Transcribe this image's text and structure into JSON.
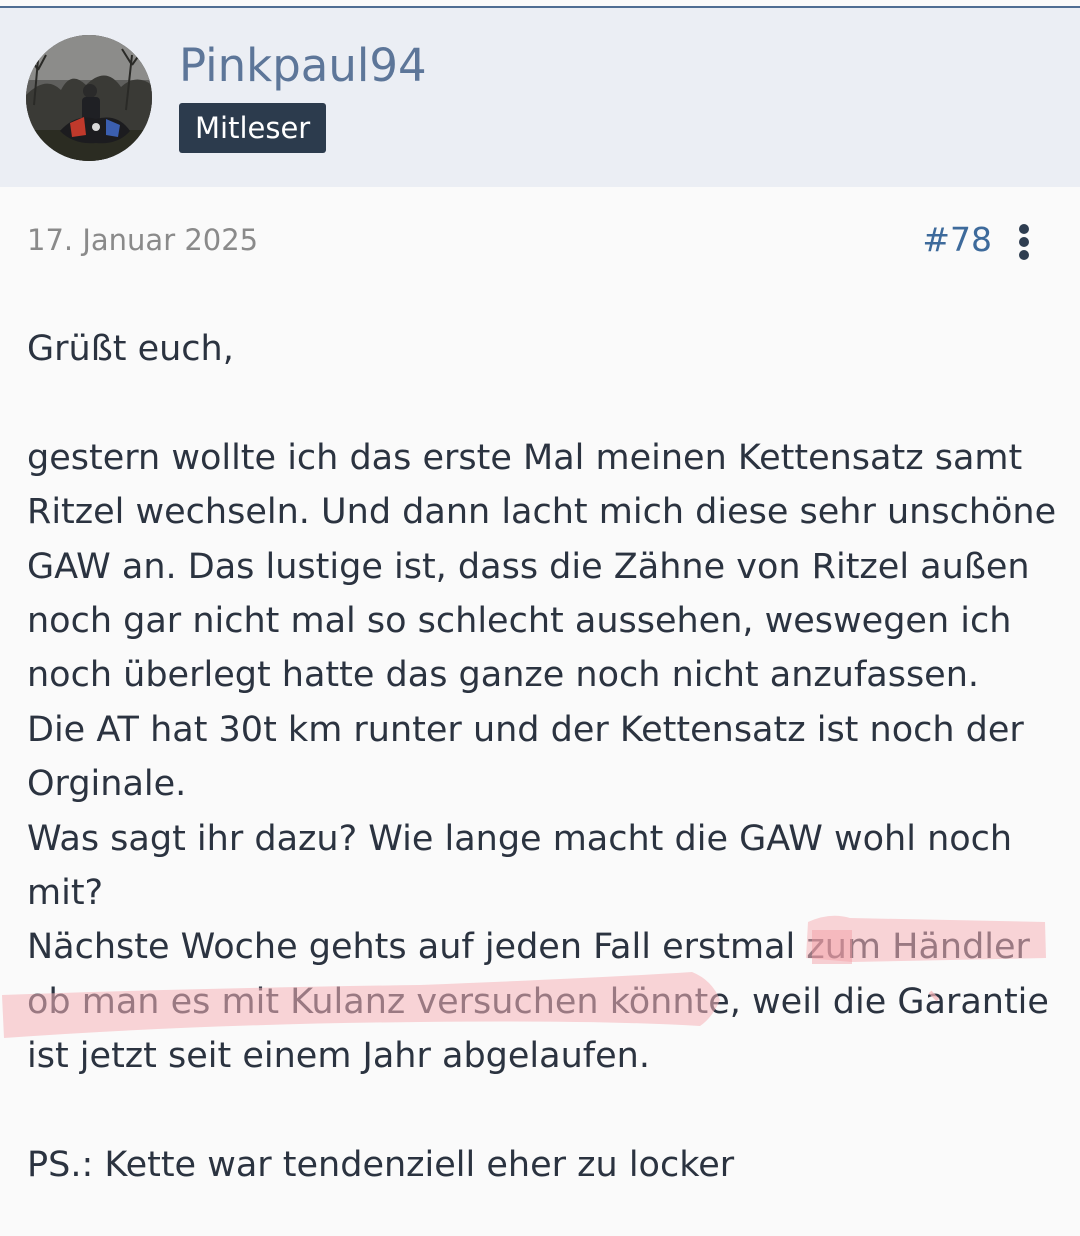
{
  "author": {
    "username": "Pinkpaul94",
    "rank": "Mitleser",
    "avatar_icon": "user-avatar-photo"
  },
  "post": {
    "date": "17. Januar 2025",
    "number": "#78",
    "menu_icon": "more-vertical-icon",
    "lines": [
      "Grüßt euch,",
      "",
      "gestern wollte ich das erste Mal meinen Kettensatz samt",
      "Ritzel wechseln. Und dann lacht mich diese sehr unschöne",
      "GAW an. Das lustige ist, dass die Zähne von Ritzel außen",
      "noch gar nicht mal so schlecht aussehen, weswegen ich",
      "noch überlegt hatte das ganze noch nicht anzufassen.",
      "Die AT hat 30t km runter und der Kettensatz ist noch der",
      "Orginale.",
      "Was sagt ihr dazu? Wie lange macht die GAW wohl noch",
      "mit?",
      "Nächste Woche gehts auf jeden Fall erstmal zum Händler",
      "ob man es mit Kulanz versuchen könnte, weil die Garantie",
      "ist jetzt seit einem Jahr abgelaufen.",
      "",
      "PS.: Kette war tendenziell eher zu locker"
    ]
  },
  "colors": {
    "header_bg": "#ebeef4",
    "username": "#5d7699",
    "badge_bg": "#2c3b4d",
    "post_number": "#3d6a9b",
    "body_text": "#2b3340",
    "highlighter": "#f6b3b8"
  }
}
